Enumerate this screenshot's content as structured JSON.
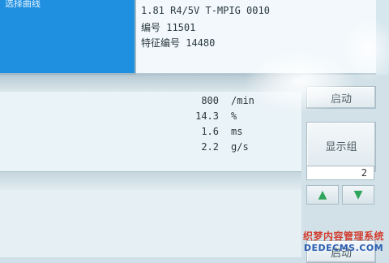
{
  "list_panel": {
    "title": "选择曲线"
  },
  "info": {
    "line1": "1.81 R4/5V T-MPIG   0010",
    "line2": "编号 11501",
    "line3": "特征编号 14480"
  },
  "readings": [
    {
      "value": "800",
      "unit": "/min"
    },
    {
      "value": "14.3",
      "unit": "%"
    },
    {
      "value": "1.6",
      "unit": "ms"
    },
    {
      "value": "2.2",
      "unit": "g/s"
    }
  ],
  "softkeys": {
    "start_label": "启动",
    "display_group_label": "显示组",
    "group_value": "2",
    "up_icon": "▲",
    "down_icon": "▼",
    "start_bottom_label": "启动"
  },
  "watermark": {
    "cn": "织梦内容管理系统",
    "en": "DEDECMS.COM"
  },
  "colors": {
    "list_blue": "#1f8fe0",
    "arrow_green": "#2ea55b"
  }
}
